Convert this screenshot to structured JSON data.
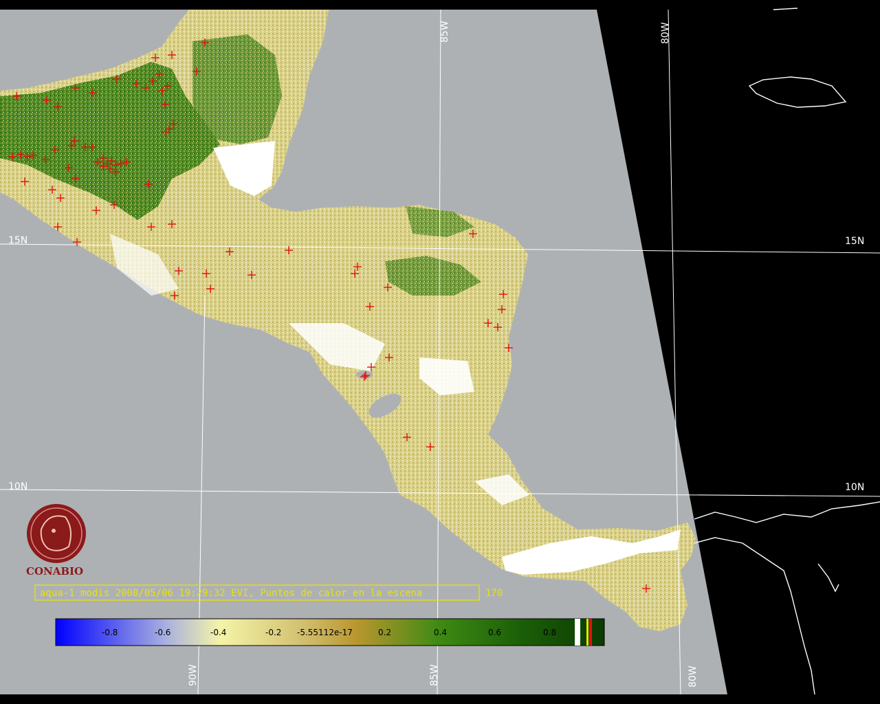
{
  "grid_labels": {
    "lon_top": [
      "85W",
      "80W"
    ],
    "lon_bottom": [
      "90W",
      "85W",
      "80W"
    ],
    "lat_left": [
      "15N",
      "10N"
    ],
    "lat_right": [
      "15N",
      "10N"
    ]
  },
  "logo": {
    "name": "CONABIO"
  },
  "caption": {
    "text": "aqua-1 modis 2008/05/06 19:29:32 EVI, Puntos de calor en la escena",
    "count": "170"
  },
  "colorbar": {
    "ticks": [
      "-0.8",
      "-0.6",
      "-0.4",
      "-0.2",
      "-5.55112e-17",
      "0.2",
      "0.4",
      "0.6",
      "0.8"
    ],
    "stops": [
      {
        "value": -1.0,
        "color": "#0000ff"
      },
      {
        "value": -0.6,
        "color": "#a8b0e0"
      },
      {
        "value": -0.4,
        "color": "#f4f4a8"
      },
      {
        "value": -0.1,
        "color": "#d2c070"
      },
      {
        "value": 0.1,
        "color": "#b8962e"
      },
      {
        "value": 0.4,
        "color": "#3e8a14"
      },
      {
        "value": 0.7,
        "color": "#1b5e08"
      },
      {
        "value": 0.85,
        "color": "#0c3a02"
      }
    ]
  },
  "colors": {
    "ocean": "#aeb1b4",
    "space": "#000000",
    "hotspot": "#e01010",
    "cloud": "#ffffff",
    "caption": "#e8e400"
  }
}
